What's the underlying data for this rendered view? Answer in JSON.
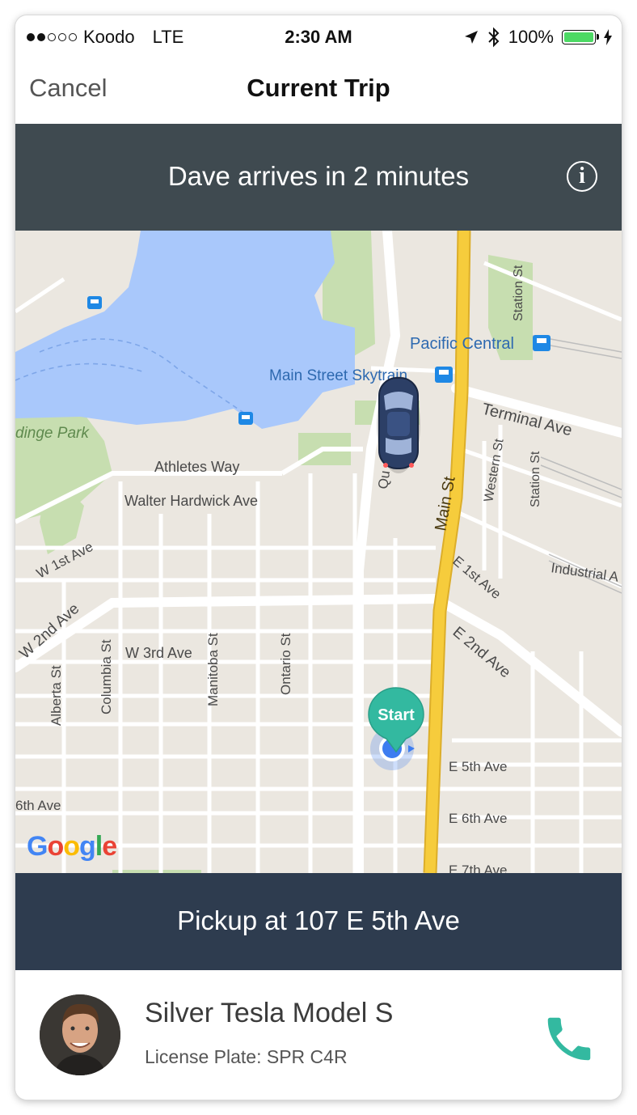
{
  "status_bar": {
    "signal_dots_filled": 2,
    "signal_dots_total": 5,
    "carrier": "Koodo",
    "network": "LTE",
    "time": "2:30 AM",
    "battery": "100%",
    "icons": [
      "location-arrow-icon",
      "bluetooth-icon",
      "battery-icon",
      "charging-bolt-icon"
    ]
  },
  "nav": {
    "cancel_label": "Cancel",
    "title": "Current Trip"
  },
  "eta_banner": {
    "text": "Dave arrives in 2 minutes",
    "info_glyph": "i"
  },
  "map": {
    "labels": {
      "park": "dinge Park",
      "athletes": "Athletes Way",
      "walter": "Walter Hardwick Ave",
      "w1st": "W 1st Ave",
      "w2nd": "W 2nd Ave",
      "w3rd": "W 3rd Ave",
      "alberta": "Alberta St",
      "columbia": "Columbia St",
      "manitoba": "Manitoba St",
      "ontario": "Ontario St",
      "sixth_w": "6th Ave",
      "pacific_central": "Pacific Central",
      "main_skytrain": "Main Street Skytrain",
      "terminal": "Terminal Ave",
      "station1": "Station St",
      "station2": "Station St",
      "western": "Western St",
      "main": "Main St",
      "quebec": "Qu",
      "e1st": "E 1st Ave",
      "industrial": "Industrial A",
      "e2nd": "E 2nd Ave",
      "e5th": "E 5th Ave",
      "e6th": "E 6th Ave",
      "e7th": "E 7th Ave"
    },
    "start_pin_label": "Start",
    "google_logo": [
      "G",
      "o",
      "o",
      "g",
      "l",
      "e"
    ],
    "colors": {
      "land": "#ebe7e0",
      "water": "#a9c8fb",
      "park": "#c7deb0",
      "highway": "#f6cc3c",
      "start_pin": "#33b9a0",
      "user_dot": "#3d7cf0"
    }
  },
  "pickup_banner": {
    "text": "Pickup at 107 E 5th Ave"
  },
  "driver": {
    "car": "Silver Tesla Model S",
    "plate": "License Plate: SPR C4R"
  },
  "colors": {
    "eta_banner_bg": "#3f4a50",
    "pickup_banner_bg": "#2e3c4f",
    "phone_icon": "#33b9a0"
  }
}
